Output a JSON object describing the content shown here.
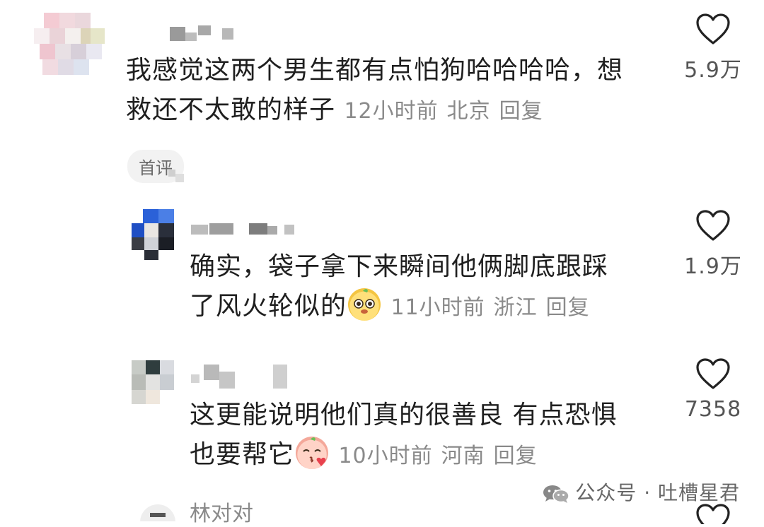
{
  "comments": [
    {
      "text_line1": "我感觉这两个男生都有点怕狗哈哈哈哈，想",
      "text_line2": "救还不太敢的样子",
      "time": "12小时前",
      "location": "北京",
      "reply": "回复",
      "likes": "5.9万",
      "badge": "首评"
    },
    {
      "text_line1": "确实，袋子拿下来瞬间他俩脚底跟踩",
      "text_line2": "了风火轮似的",
      "time": "11小时前",
      "location": "浙江",
      "reply": "回复",
      "likes": "1.9万",
      "emoji": "yellow-face-emoji"
    },
    {
      "text_line1": "这更能说明他们真的很善良 有点恐惧",
      "text_line2": "也要帮它",
      "time": "10小时前",
      "location": "河南",
      "reply": "回复",
      "likes": "7358",
      "emoji": "pink-kiss-emoji"
    },
    {
      "username": "林对对"
    }
  ],
  "watermark": {
    "text": "公众号 · 吐槽星君",
    "icon": "wechat-icon"
  },
  "colors": {
    "text": "#1f1f1f",
    "meta": "#8a8a8a",
    "badge_bg": "#f2f2f2"
  }
}
